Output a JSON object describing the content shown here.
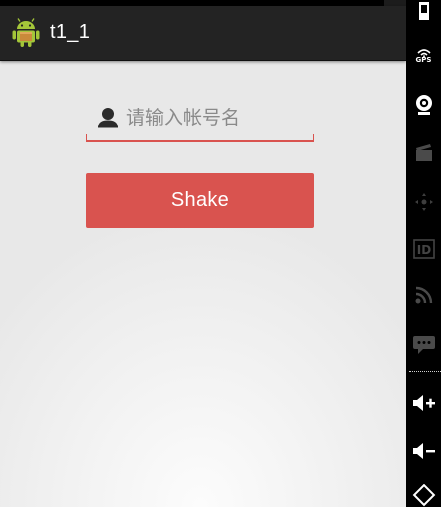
{
  "app": {
    "title": "t1_1",
    "icon": "android-icon"
  },
  "form": {
    "account_placeholder": "请输入帐号名",
    "account_value": "",
    "account_icon": "user-icon",
    "shake_label": "Shake"
  },
  "emulator_sidebar": {
    "gps_label": "GPS",
    "items": [
      "battery-icon",
      "gps-icon",
      "camera-icon",
      "video-clapper-icon",
      "dpad-icon",
      "id-icon",
      "rss-icon",
      "sms-icon",
      "volume-up-icon",
      "volume-down-icon",
      "rotate-icon"
    ]
  },
  "colors": {
    "accent": "#d9534f",
    "action_bar": "#232323",
    "android_green": "#a4c639",
    "background": "#efefef"
  }
}
